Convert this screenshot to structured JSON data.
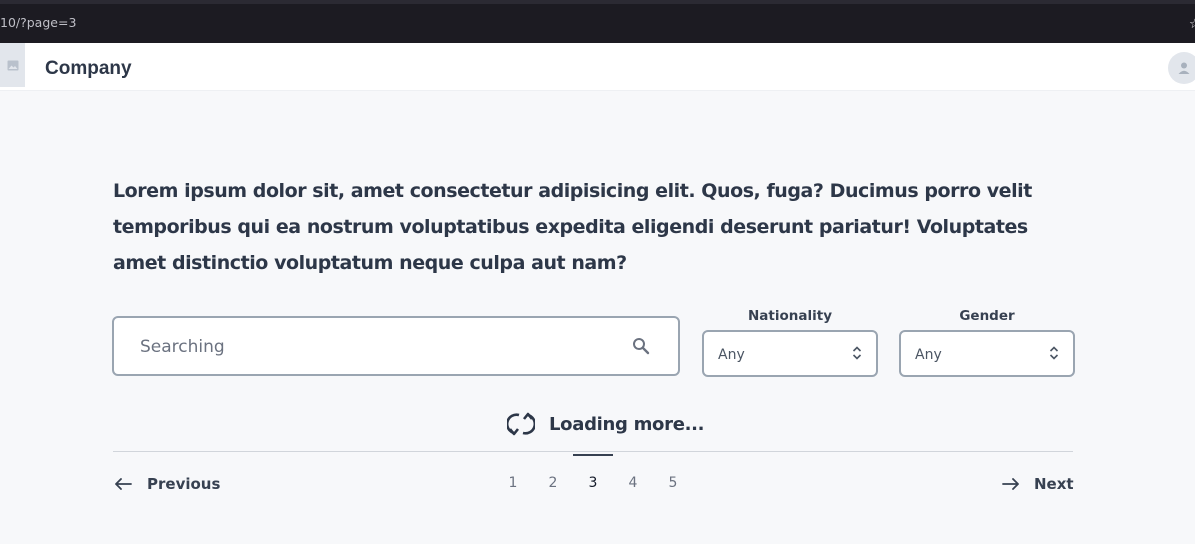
{
  "browser": {
    "url_fragment": "10/?page=3"
  },
  "header": {
    "title": "Company",
    "logo_icon": "image-icon",
    "avatar_icon": "user-icon"
  },
  "intro": "Lorem ipsum dolor sit, amet consectetur adipisicing elit. Quos, fuga? Ducimus porro velit temporibus qui ea nostrum voluptatibus expedita eligendi deserunt pariatur! Voluptates amet distinctio voluptatum neque culpa aut nam?",
  "search": {
    "placeholder": "Searching",
    "icon": "search-icon"
  },
  "filters": {
    "nationality": {
      "label": "Nationality",
      "value": "Any"
    },
    "gender": {
      "label": "Gender",
      "value": "Any"
    }
  },
  "loading": {
    "text": "Loading more...",
    "icon": "refresh-icon"
  },
  "pagination": {
    "previous": "Previous",
    "next": "Next",
    "pages": [
      "1",
      "2",
      "3",
      "4",
      "5"
    ],
    "current": "3"
  },
  "colors": {
    "background": "#f7f8fa",
    "border": "#9aa5b1",
    "text": "#2d3748"
  }
}
